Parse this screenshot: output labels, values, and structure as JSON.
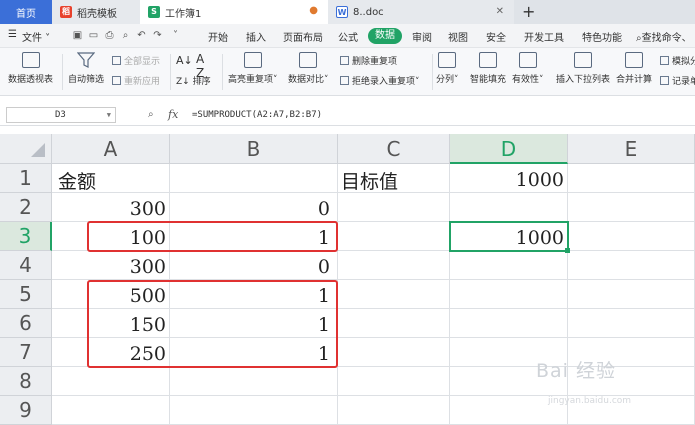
{
  "tabs": [
    {
      "label": "首页"
    },
    {
      "label": "稻壳模板"
    },
    {
      "label": "工作簿1"
    },
    {
      "label": "8..doc"
    }
  ],
  "menu": {
    "file_label": "文件",
    "items": [
      "开始",
      "插入",
      "页面布局",
      "公式",
      "数据",
      "审阅",
      "视图",
      "安全",
      "开发工具",
      "特色功能"
    ],
    "search_label": "查找命令、"
  },
  "ribbon": {
    "pivot": "数据透视表",
    "autofilter": "自动筛选",
    "show_all": "全部显示",
    "reapply": "重新应用",
    "sort": "排序",
    "highlight_dup": "高亮重复项",
    "compare": "数据对比",
    "remove_dup": "删除重复项",
    "reject_dup": "拒绝录入重复项",
    "split": "分列",
    "smart_fill": "智能填充",
    "validity": "有效性",
    "dropdown": "插入下拉列表",
    "consolidate": "合并计算",
    "simulate": "模拟分",
    "record": "记录单"
  },
  "formula_bar": {
    "cell_ref": "D3",
    "fx": "fx",
    "formula": "=SUMPRODUCT(A2:A7,B2:B7)"
  },
  "columns": [
    "A",
    "B",
    "C",
    "D",
    "E"
  ],
  "rows": [
    "1",
    "2",
    "3",
    "4",
    "5",
    "6",
    "7",
    "8",
    "9"
  ],
  "cells": {
    "A1": "金额",
    "C1": "目标值",
    "D1": "1000",
    "A2": "300",
    "B2": "0",
    "A3": "100",
    "B3": "1",
    "D3": "1000",
    "A4": "300",
    "B4": "0",
    "A5": "500",
    "B5": "1",
    "A6": "150",
    "B6": "1",
    "A7": "250",
    "B7": "1"
  },
  "selected_cell": "D3",
  "watermark": {
    "main": "Bai 经验",
    "sub": "jingyan.baidu.com"
  },
  "colors": {
    "accent": "#21a366",
    "highlight": "#e03131"
  }
}
